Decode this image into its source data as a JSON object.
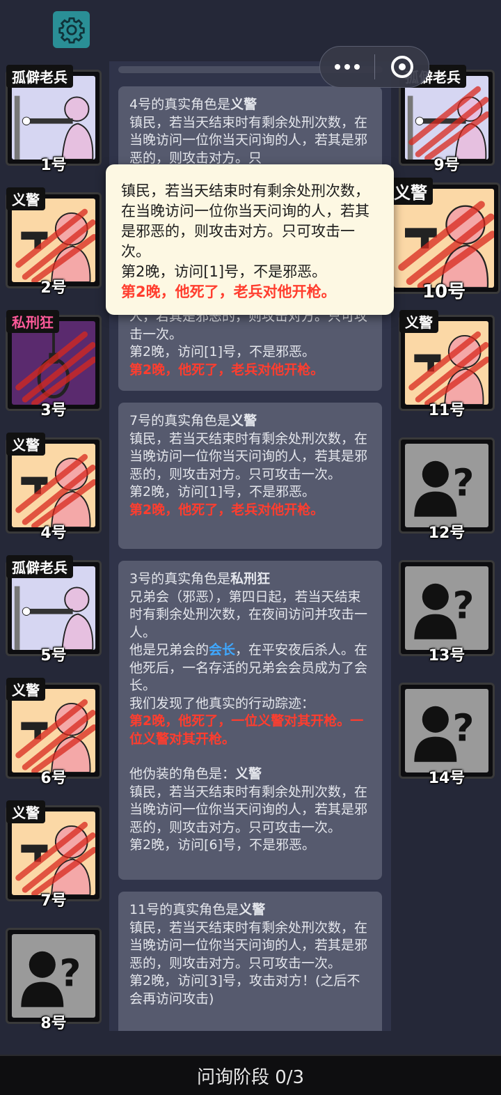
{
  "phase_label": "问询阶段 0/3",
  "left_cards": [
    {
      "tag": "孤僻老兵",
      "num": "1号",
      "art": "veteran"
    },
    {
      "tag": "义警",
      "num": "2号",
      "art": "vigilante-dead"
    },
    {
      "tag": "私刑狂",
      "num": "3号",
      "art": "noose-dead"
    },
    {
      "tag": "义警",
      "num": "4号",
      "art": "vigilante-dead"
    },
    {
      "tag": "孤僻老兵",
      "num": "5号",
      "art": "veteran"
    },
    {
      "tag": "义警",
      "num": "6号",
      "art": "vigilante-dead"
    },
    {
      "tag": "义警",
      "num": "7号",
      "art": "vigilante-dead"
    },
    {
      "tag": "",
      "num": "8号",
      "art": "unknown"
    }
  ],
  "right_cards": [
    {
      "tag": "孤僻老兵",
      "num": "9号",
      "art": "veteran-dead"
    },
    {
      "tag": "义警",
      "num": "10号",
      "art": "vigilante-dead"
    },
    {
      "tag": "义警",
      "num": "11号",
      "art": "vigilante-dead"
    },
    {
      "tag": "",
      "num": "12号",
      "art": "unknown"
    },
    {
      "tag": "",
      "num": "13号",
      "art": "unknown"
    },
    {
      "tag": "",
      "num": "14号",
      "art": "unknown"
    }
  ],
  "messages": {
    "m1": {
      "head": "4号的真实角色是",
      "role": "义警",
      "body": "镇民，若当天结束时有剩余处刑次数，在当晚访问一位你当天问询的人，若其是邪恶的，则攻击对方。只"
    },
    "m2": {
      "body": "人，若其是邪恶的，则攻击对方。只可攻击一次。",
      "visit": "第2晚，访问[1]号，不是邪恶。",
      "death": "第2晚，他死了，老兵对他开枪。"
    },
    "m3": {
      "head": "7号的真实角色是",
      "role": "义警",
      "body": "镇民，若当天结束时有剩余处刑次数，在当晚访问一位你当天问询的人，若其是邪恶的，则攻击对方。只可攻击一次。",
      "visit": "第2晚，访问[1]号，不是邪恶。",
      "death": "第2晚，他死了，老兵对他开枪。"
    },
    "m4": {
      "head": "3号的真实角色是",
      "role": "私刑狂",
      "body1": "兄弟会（邪恶），第四日起，若当天结束时有剩余处刑次数，在夜间访问并攻击一人。",
      "body2a": "他是兄弟会的",
      "leader": "会长",
      "body2b": "，在平安夜后杀人。在他死后，一名存活的兄弟会会员成为了会长。",
      "trace": "我们发现了他真实的行动踪迹：",
      "death": "第2晚，他死了，一位义警对其开枪。一位义警对其开枪。",
      "disguise": "他伪装的角色是：",
      "disguise_role": "义警",
      "body3": "镇民，若当天结束时有剩余处刑次数，在当晚访问一位你当天问询的人，若其是邪恶的，则攻击对方。只可攻击一次。",
      "visit": "第2晚，访问[6]号，不是邪恶。"
    },
    "m5": {
      "head": "11号的真实角色是",
      "role": "义警",
      "body": "镇民，若当天结束时有剩余处刑次数，在当晚访问一位你当天问询的人，若其是邪恶的，则攻击对方。只可攻击一次。",
      "visit": "第2晚，访问[3]号，攻击对方！(之后不会再访问攻击)"
    }
  },
  "tooltip": {
    "body": "镇民，若当天结束时有剩余处刑次数，在当晚访问一位你当天问询的人，若其是邪恶的，则攻击对方。只可攻击一次。",
    "visit": "第2晚，访问[1]号，不是邪恶。",
    "death": "第2晚，他死了，老兵对他开枪。"
  },
  "colors": {
    "background": "#252838",
    "message_bg": "#565a6e",
    "accent_red": "#ff3d2e",
    "accent_blue": "#3fa8ff",
    "settings_teal": "#2a8f96"
  },
  "icons": [
    "gear-icon",
    "more-dots-icon",
    "target-icon",
    "unknown-person-icon"
  ]
}
